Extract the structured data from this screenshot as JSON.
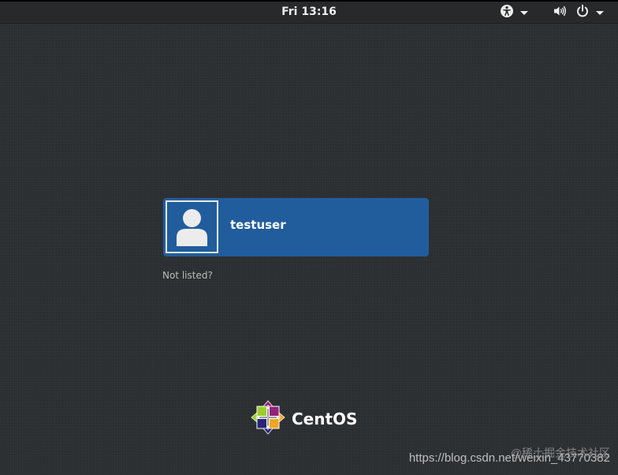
{
  "topbar": {
    "clock": "Fri 13:16",
    "icons": {
      "accessibility": "accessibility-icon",
      "volume": "volume-icon",
      "power": "power-icon",
      "menu_arrow": "chevron-down-icon"
    }
  },
  "user_list": {
    "users": [
      {
        "username": "testuser",
        "avatar": "default-user-avatar-icon"
      }
    ],
    "not_listed_label": "Not listed?"
  },
  "branding": {
    "logo_text": "CentOS",
    "logo_icon": "centos-logo-icon"
  },
  "watermark": {
    "text": "https://blog.csdn.net/weixin_43770382",
    "logo_text": "@稀土掘金技术社区"
  },
  "colors": {
    "background": "#2c2f32",
    "topbar": "#27292b",
    "selected_user": "#215d9c",
    "text": "#ffffff",
    "secondary_text": "#babdb6"
  }
}
